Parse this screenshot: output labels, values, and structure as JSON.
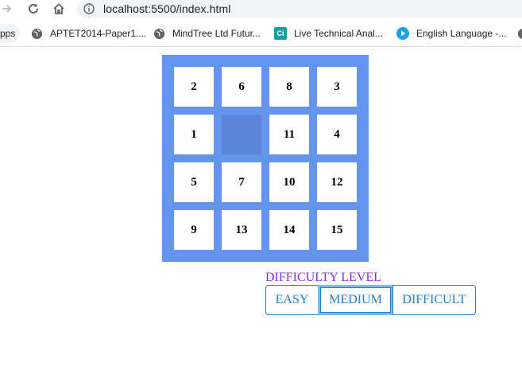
{
  "browser": {
    "url": "localhost:5500/index.html",
    "bookmarks": [
      {
        "label": "pps",
        "icon": "apps-icon"
      },
      {
        "label": "APTET2014-Paper1....",
        "icon": "globe-icon"
      },
      {
        "label": "MindTree Ltd Futur...",
        "icon": "globe-icon"
      },
      {
        "label": "Live Technical Anal...",
        "icon": "ci-icon",
        "icon_text": "Ci"
      },
      {
        "label": "English Language -...",
        "icon": "play-icon"
      }
    ]
  },
  "puzzle": {
    "tiles": [
      "2",
      "6",
      "8",
      "3",
      "1",
      "",
      "11",
      "4",
      "5",
      "7",
      "10",
      "12",
      "9",
      "13",
      "14",
      "15"
    ],
    "board_color": "#6495ed",
    "empty_tile_color": "#5b86d8"
  },
  "difficulty": {
    "title": "DIFFICULTY LEVEL",
    "options": [
      "EASY",
      "MEDIUM",
      "DIFFICULT"
    ],
    "selected": "MEDIUM",
    "accent_color": "#1e7fd6",
    "title_color": "#8a2be2"
  }
}
